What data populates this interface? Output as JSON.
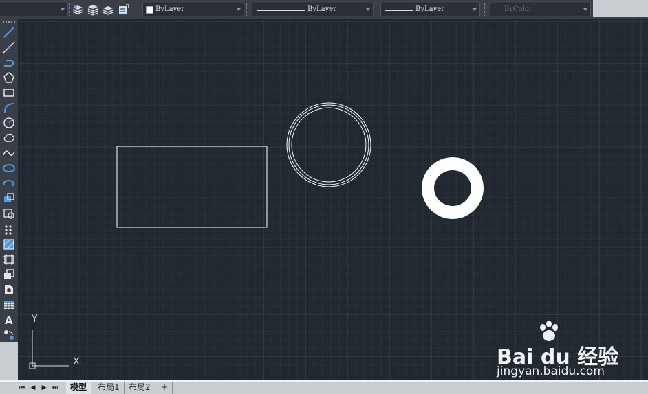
{
  "properties_toolbar": {
    "color_combo": {
      "value": "ByLayer"
    },
    "linetype_combo": {
      "value": "ByLayer"
    },
    "lineweight_combo": {
      "value": "ByLayer"
    },
    "plotstyle_combo": {
      "value": "ByColor"
    },
    "layer_icons": [
      "layer-stack-icon",
      "layer-states-icon",
      "layer-previous-icon",
      "layer-properties-icon"
    ]
  },
  "draw_toolbar": {
    "tools": [
      "line-icon",
      "construction-line-icon",
      "polyline-icon",
      "polygon-icon",
      "rectangle-icon",
      "arc-icon",
      "circle-icon",
      "revision-cloud-icon",
      "spline-icon",
      "ellipse-icon",
      "ellipse-arc-icon",
      "insert-block-icon",
      "make-block-icon",
      "point-icon",
      "hatch-icon",
      "gradient-icon",
      "region-icon",
      "table-icon",
      "multiline-text-icon",
      "add-selected-icon"
    ]
  },
  "ucs": {
    "x_label": "X",
    "y_label": "Y"
  },
  "layout_tabs": [
    {
      "label": "模型",
      "active": true
    },
    {
      "label": "布局1",
      "active": false
    },
    {
      "label": "布局2",
      "active": false
    },
    {
      "label": "+",
      "active": false
    }
  ],
  "watermark": {
    "brand_text": "Bai du 经验",
    "url": "jingyan.baidu.com"
  },
  "colors": {
    "canvas_bg": "#212830",
    "toolbar_bg": "#3a3f47",
    "accent_blue": "#3d8bd9",
    "drawing_white": "#ffffff"
  }
}
